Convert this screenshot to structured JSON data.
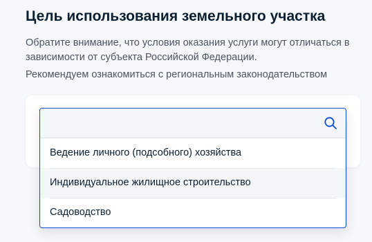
{
  "heading": {
    "title": "Цель использования земельного участка",
    "notice": "Обратите внимание, что условия оказания услуги могут отличаться в зависимости от субъекта Российской Федерации.",
    "recommendation": "Рекомендуем ознакомиться с региональным законодательством"
  },
  "dropdown": {
    "search_value": "",
    "search_placeholder": "",
    "search_icon": "search-icon",
    "options": [
      {
        "label": "Ведение личного (подсобного) хозяйства"
      },
      {
        "label": "Индивидуальное жилищное строительство"
      },
      {
        "label": "Садоводство"
      }
    ],
    "highlighted_index": 1
  },
  "colors": {
    "accent": "#0d4cd3",
    "text": "#0b1f33",
    "muted_text": "#4a5461",
    "background": "#f7f8fb"
  }
}
